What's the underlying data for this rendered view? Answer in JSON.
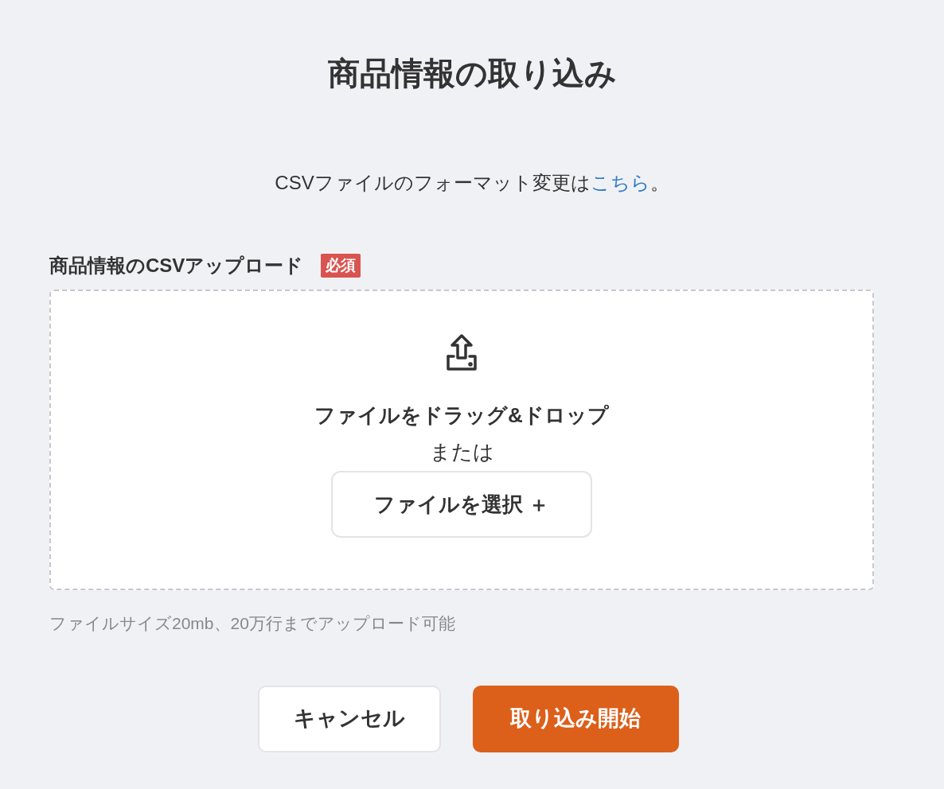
{
  "title": "商品情報の取り込み",
  "format_note": {
    "text": "CSVファイルのフォーマット変更は",
    "link": "こちら",
    "suffix": "。"
  },
  "upload": {
    "label": "商品情報のCSVアップロード",
    "badge": "必須",
    "drop_text": "ファイルをドラッグ&ドロップ",
    "or_text": "または",
    "select_button": "ファイルを選択 ＋",
    "hint": "ファイルサイズ20mb、20万行までアップロード可能"
  },
  "buttons": [
    {
      "label": "キャンセル",
      "kind": "secondary"
    },
    {
      "label": "取り込み開始",
      "kind": "primary"
    }
  ]
}
